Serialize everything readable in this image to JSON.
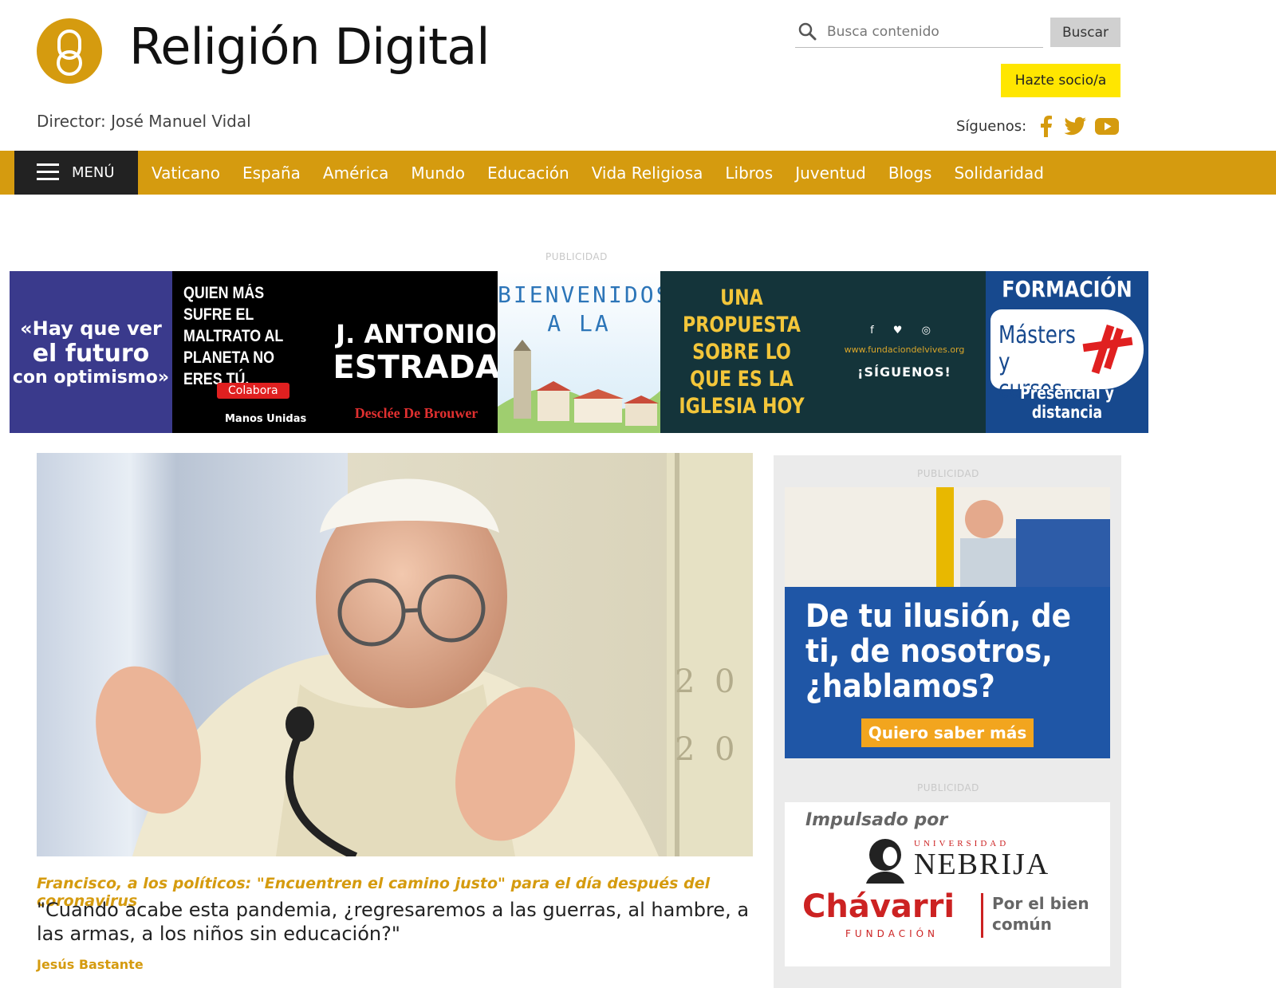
{
  "header": {
    "site_title": "Religión Digital",
    "director": "Director: José Manuel Vidal",
    "search_placeholder": "Busca contenido",
    "search_button": "Buscar",
    "socio_button": "Hazte socio/a",
    "follow_label": "Síguenos:",
    "social_icons": [
      "facebook-icon",
      "twitter-icon",
      "youtube-icon"
    ]
  },
  "nav": {
    "menu_label": "MENÚ",
    "items": [
      {
        "label": "Vaticano"
      },
      {
        "label": "España"
      },
      {
        "label": "América"
      },
      {
        "label": "Mundo"
      },
      {
        "label": "Educación"
      },
      {
        "label": "Vida Religiosa"
      },
      {
        "label": "Libros"
      },
      {
        "label": "Juventud"
      },
      {
        "label": "Blogs"
      },
      {
        "label": "Solidaridad"
      }
    ]
  },
  "ads": {
    "label": "PUBLICIDAD",
    "banner": {
      "t1": {
        "l1": "«Hay que ver",
        "l2": "el futuro",
        "l3": "con optimismo»"
      },
      "t2": {
        "quote": "QUIEN MÁS SUFRE EL MALTRATO AL PLANETA NO ERES TÚ.",
        "cta": "Colabora",
        "brand": "Manos Unidas"
      },
      "t3": {
        "name1": "J. ANTONIO",
        "name2": "ESTRADA",
        "publisher": "Desclée De Brouwer"
      },
      "t4": {
        "text": "BIENVENIDOS A LA"
      },
      "t5": {
        "text": "UNA PROPUESTA SOBRE LO QUE ES LA IGLESIA HOY"
      },
      "t6": {
        "socials": "f ♥ ◎",
        "url": "www.fundaciondelvives.org",
        "follow": "¡SÍGUENOS!"
      },
      "t7": {
        "title": "FORMACIÓN",
        "pill": "Másters y cursos",
        "footer": "Presencial y distancia"
      }
    },
    "sidebar_1": {
      "text": "De tu ilusión, de ti, de nosotros, ¿hablamos?",
      "cta": "Quiero saber más"
    },
    "sidebar_2": {
      "impulsado": "Impulsado por",
      "universidad": "UNIVERSIDAD",
      "nebrija": "NEBRIJA",
      "chavarri": "Chávarri",
      "fundacion": "FUNDACIÓN",
      "bien_comun": "Por el bien común"
    }
  },
  "story": {
    "kicker": "Francisco, a los políticos: \"Encuentren el camino justo\" para el día después del coronavirus",
    "headline": "\"Cuando acabe esta pandemia, ¿regresaremos a las guerras, al hambre, a las armas, a los niños sin educación?\"",
    "byline": "Jesús Bastante"
  },
  "colors": {
    "brand_gold": "#d59b0f",
    "nav_dark": "#222222",
    "socio_yellow": "#ffe600"
  }
}
